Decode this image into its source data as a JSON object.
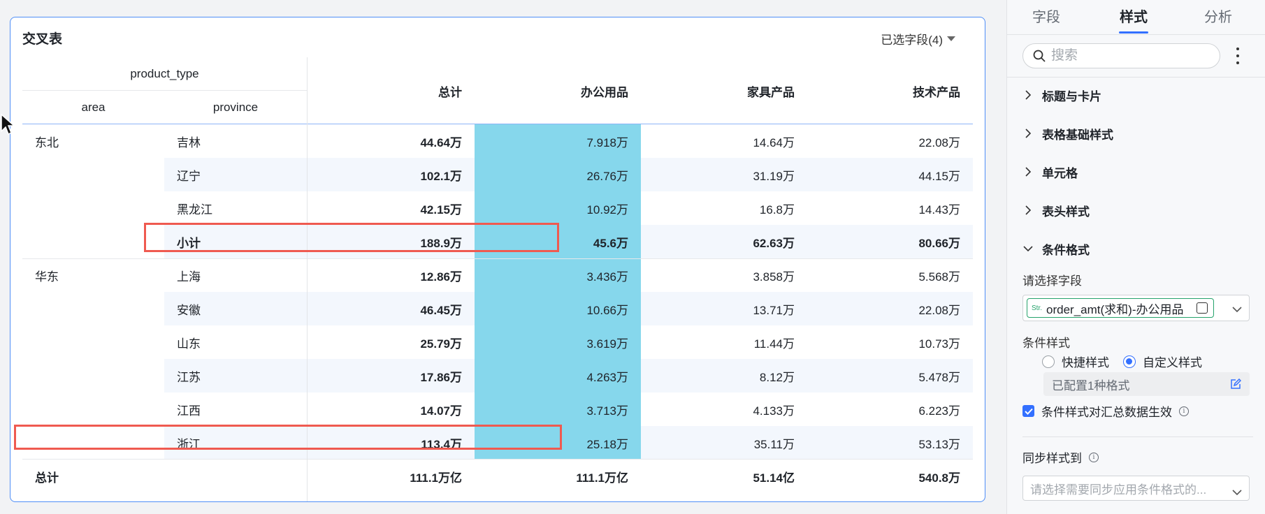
{
  "card": {
    "title": "交叉表",
    "field_picker": "已选字段(4)"
  },
  "table": {
    "column_dimension": "product_type",
    "row_dimensions": [
      "area",
      "province"
    ],
    "columns": [
      "总计",
      "办公用品",
      "家具产品",
      "技术产品"
    ],
    "rows": [
      {
        "area": "东北",
        "province": "吉林",
        "values": [
          "44.64万",
          "7.918万",
          "14.64万",
          "22.08万"
        ]
      },
      {
        "area": "",
        "province": "辽宁",
        "values": [
          "102.1万",
          "26.76万",
          "31.19万",
          "44.15万"
        ]
      },
      {
        "area": "",
        "province": "黑龙江",
        "values": [
          "42.15万",
          "10.92万",
          "16.8万",
          "14.43万"
        ]
      },
      {
        "area": "",
        "province": "小计",
        "values": [
          "188.9万",
          "45.6万",
          "62.63万",
          "80.66万"
        ]
      },
      {
        "area": "华东",
        "province": "上海",
        "values": [
          "12.86万",
          "3.436万",
          "3.858万",
          "5.568万"
        ]
      },
      {
        "area": "",
        "province": "安徽",
        "values": [
          "46.45万",
          "10.66万",
          "13.71万",
          "22.08万"
        ]
      },
      {
        "area": "",
        "province": "山东",
        "values": [
          "25.79万",
          "3.619万",
          "11.44万",
          "10.73万"
        ]
      },
      {
        "area": "",
        "province": "江苏",
        "values": [
          "17.86万",
          "4.263万",
          "8.12万",
          "5.478万"
        ]
      },
      {
        "area": "",
        "province": "江西",
        "values": [
          "14.07万",
          "3.713万",
          "4.133万",
          "6.223万"
        ]
      },
      {
        "area": "",
        "province": "浙江",
        "values": [
          "113.4万",
          "25.18万",
          "35.11万",
          "53.13万"
        ]
      }
    ],
    "total": {
      "label": "总计",
      "values": [
        "111.1万亿",
        "111.1万亿",
        "51.14亿",
        "540.8万"
      ]
    },
    "highlight_color": "#86d7ec",
    "callout_color": "#ef5a50"
  },
  "panel": {
    "tabs": [
      "字段",
      "样式",
      "分析"
    ],
    "active_tab": "样式",
    "search_placeholder": "搜索",
    "sections": [
      "标题与卡片",
      "表格基础样式",
      "单元格",
      "表头样式",
      "条件格式"
    ],
    "conditional": {
      "field_label": "请选择字段",
      "field_type": "Str.",
      "field_value": "order_amt(求和)-办公用品",
      "style_label": "条件样式",
      "quick_style": "快捷样式",
      "custom_style": "自定义样式",
      "configured": "已配置1种格式",
      "apply_to_total": "条件样式对汇总数据生效",
      "sync_label": "同步样式到",
      "sync_placeholder": "请选择需要同步应用条件格式的..."
    },
    "accent_color": "#3370ff"
  }
}
